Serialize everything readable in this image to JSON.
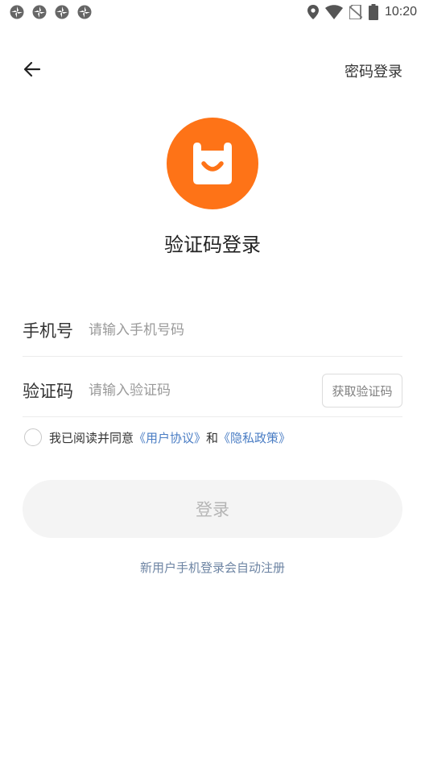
{
  "status_bar": {
    "time": "10:20",
    "left_icons": [
      "app-notification-icon",
      "app-notification-icon",
      "app-notification-icon",
      "app-notification-icon"
    ],
    "right_icons": [
      "location-icon",
      "wifi-icon",
      "no-sim-icon",
      "battery-icon"
    ]
  },
  "header": {
    "back_icon": "arrow-left-icon",
    "password_login_label": "密码登录"
  },
  "logo": {
    "color": "#fe7317",
    "icon": "bag-smile-icon"
  },
  "title": "验证码登录",
  "form": {
    "phone": {
      "label": "手机号",
      "placeholder": "请输入手机号码",
      "value": ""
    },
    "code": {
      "label": "验证码",
      "placeholder": "请输入验证码",
      "value": "",
      "get_code_label": "获取验证码"
    }
  },
  "agreement": {
    "checked": false,
    "prefix": "我已阅读并同意",
    "user_agreement": "《用户协议》",
    "conjunction": "和",
    "privacy_policy": "《隐私政策》"
  },
  "login_button_label": "登录",
  "auto_register_note": "新用户手机登录会自动注册",
  "colors": {
    "brand": "#fe7317",
    "link": "#4a7dc4",
    "hint": "#6d84a3",
    "disabled_button_bg": "#f4f4f4"
  }
}
